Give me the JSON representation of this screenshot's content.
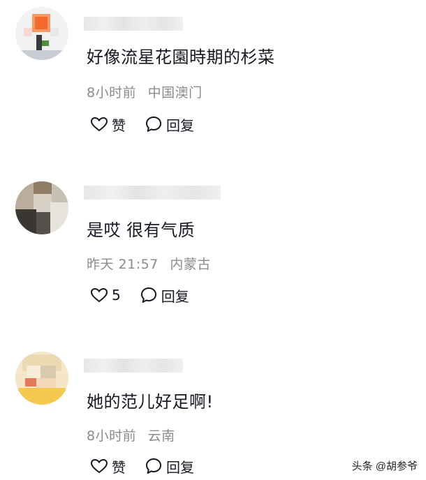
{
  "comments": [
    {
      "text": "好像流星花園時期的杉菜",
      "time": "8小时前",
      "location": "中国澳门",
      "like_label": "赞",
      "reply_label": "回复"
    },
    {
      "text": "是哎  很有气质",
      "time": "昨天 21:57",
      "location": "内蒙古",
      "like_label": "5",
      "reply_label": "回复"
    },
    {
      "text": "她的范儿好足啊!",
      "time": "8小时前",
      "location": "云南",
      "like_label": "赞",
      "reply_label": "回复"
    }
  ],
  "icons": {
    "like": "heart-outline-icon",
    "reply": "speech-bubble-icon"
  },
  "watermark": "头条 @胡参爷"
}
